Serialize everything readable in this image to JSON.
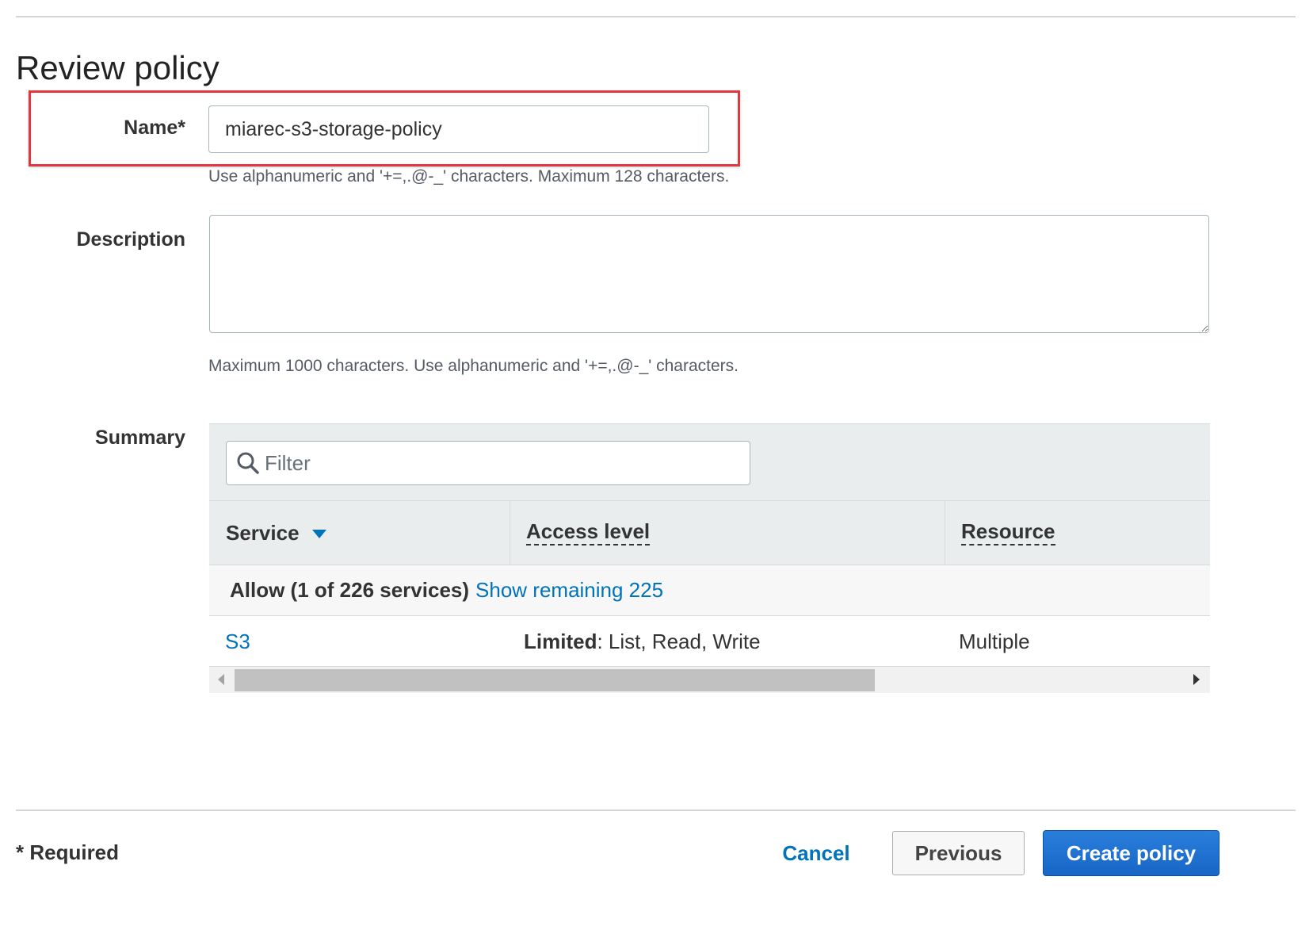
{
  "page": {
    "title": "Review policy"
  },
  "form": {
    "name_label": "Name*",
    "name_value": "miarec-s3-storage-policy",
    "name_hint": "Use alphanumeric and '+=,.@-_' characters. Maximum 128 characters.",
    "description_label": "Description",
    "description_value": "",
    "description_hint": "Maximum 1000 characters. Use alphanumeric and '+=,.@-_' characters.",
    "summary_label": "Summary"
  },
  "summary": {
    "filter_placeholder": "Filter",
    "columns": {
      "service": "Service",
      "access_level": "Access level",
      "resource": "Resource"
    },
    "allow_text": "Allow (1 of 226 services)",
    "show_remaining_link": "Show remaining 225",
    "rows": [
      {
        "service": "S3",
        "access_prefix": "Limited",
        "access_rest": ": List, Read, Write",
        "resource": "Multiple"
      }
    ]
  },
  "footer": {
    "required_note": "* Required",
    "cancel_label": "Cancel",
    "previous_label": "Previous",
    "create_label": "Create policy"
  },
  "colors": {
    "link": "#0073bb",
    "primary_button": "#1866c6",
    "highlight": "#e0383e"
  }
}
